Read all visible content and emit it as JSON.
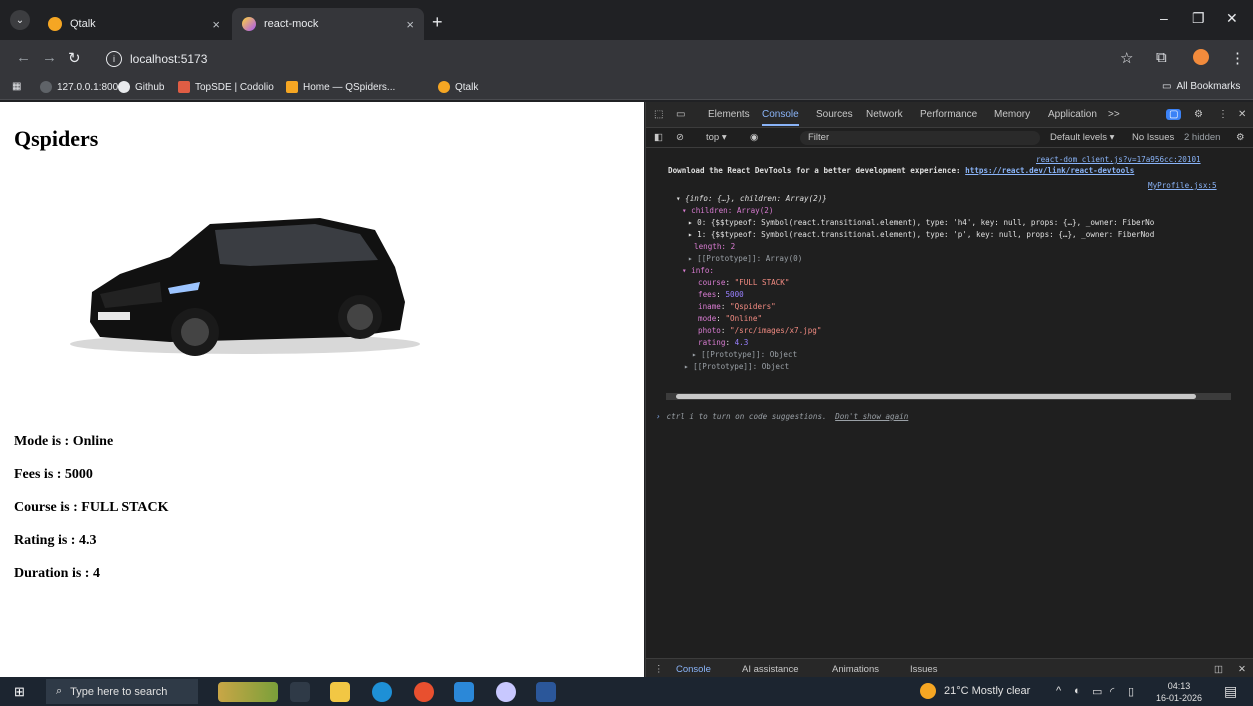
{
  "browser": {
    "tabs": [
      {
        "title": "Qtalk",
        "close": "×"
      },
      {
        "title": "react-mock",
        "close": "×"
      }
    ],
    "new_tab": "+",
    "url": "localhost:5173",
    "bookmarks": [
      {
        "label": "127.0.0.1:8000"
      },
      {
        "label": "Github"
      },
      {
        "label": "TopSDE | Codolio"
      },
      {
        "label": "Home — QSpiders..."
      },
      {
        "label": "Qtalk"
      }
    ],
    "all_bookmarks": "All Bookmarks"
  },
  "page": {
    "title": "Qspiders",
    "lines": [
      "Mode is : Online",
      "Fees is : 5000",
      "Course is : FULL STACK",
      "Rating is : 4.3",
      "Duration is : 4"
    ]
  },
  "devtools": {
    "tabs": [
      "Elements",
      "Console",
      "Sources",
      "Network",
      "Performance",
      "Memory",
      "Application"
    ],
    "more": ">>",
    "context": "top ▾",
    "filter_placeholder": "Filter",
    "levels": "Default levels ▾",
    "issues": "No Issues",
    "hidden": "2 hidden",
    "source1": "react-dom_client.js?v=17a956cc:20101",
    "msg_prefix": "Download the React DevTools for a better development experience: ",
    "msg_link": "https://react.dev/link/react-devtools",
    "source2": "MyProfile.jsx:5",
    "obj_summary": "▾ {info: {…}, children: Array(2)}",
    "children_line": "▾ children: Array(2)",
    "child0": "▸ 0: {$$typeof: Symbol(react.transitional.element), type: 'h4', key: null, props: {…}, _owner: FiberNo",
    "child1": "▸ 1: {$$typeof: Symbol(react.transitional.element), type: 'p', key: null, props: {…}, _owner: FiberNod",
    "length": "length: 2",
    "proto_array": "▸ [[Prototype]]: Array(0)",
    "info_line": "▾ info:",
    "info": [
      {
        "key": "course",
        "value": "\"FULL STACK\""
      },
      {
        "key": "fees",
        "value": "5000"
      },
      {
        "key": "iname",
        "value": "\"Qspiders\""
      },
      {
        "key": "mode",
        "value": "\"Online\""
      },
      {
        "key": "photo",
        "value": "\"/src/images/x7.jpg\""
      },
      {
        "key": "rating",
        "value": "4.3"
      }
    ],
    "proto_obj1": "▸ [[Prototype]]: Object",
    "proto_obj2": "▸ [[Prototype]]: Object",
    "hint": "ctrl i to turn on code suggestions.",
    "hint_link": "Don't show again",
    "drawer_tabs": [
      "Console",
      "AI assistance",
      "Animations",
      "Issues"
    ]
  },
  "taskbar": {
    "search_placeholder": "Type here to search",
    "weather": "21°C  Mostly clear",
    "time": "04:13",
    "date": "16-01-2026"
  },
  "colors": {
    "chrome_dark": "#202124",
    "toolbar": "#35363a",
    "devtools_bg": "#1f1f1f",
    "accent": "#8ab4f8"
  }
}
